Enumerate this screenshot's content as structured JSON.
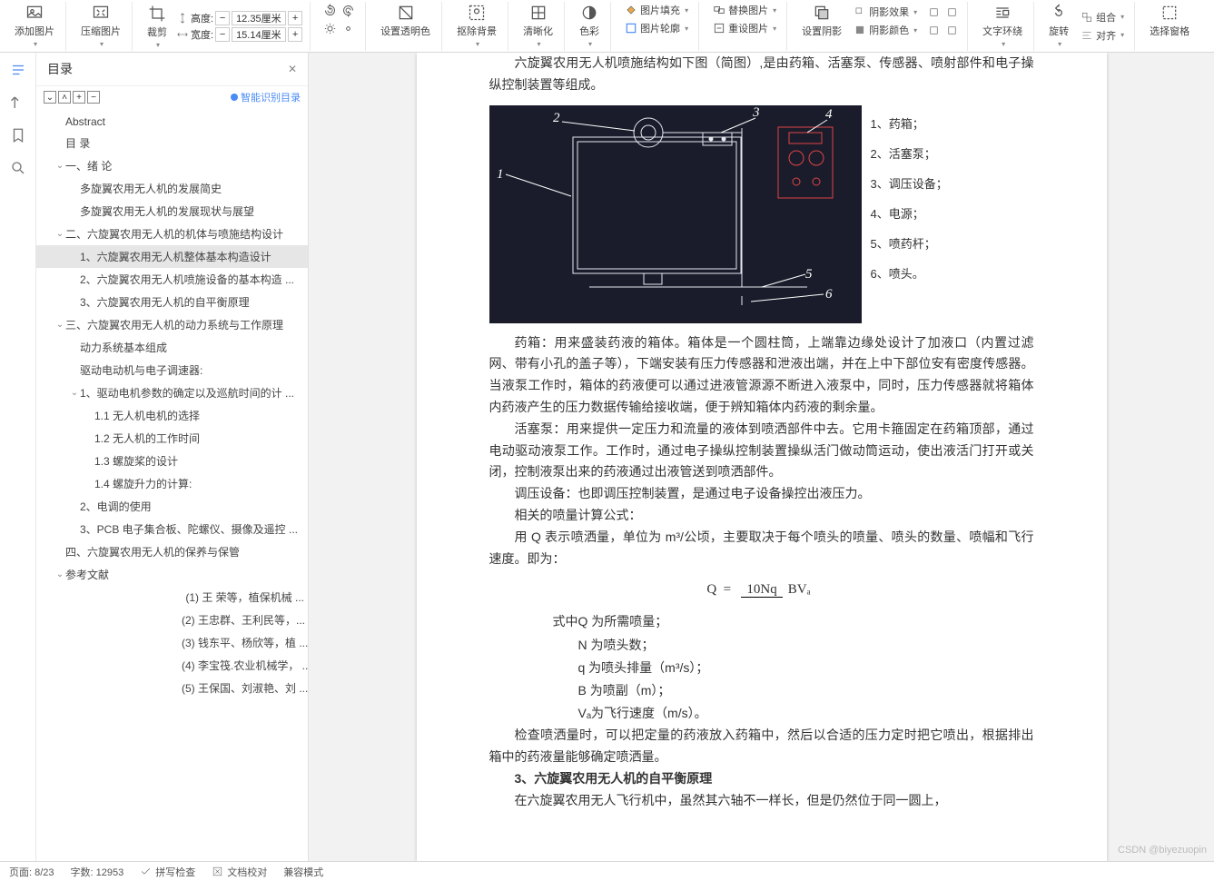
{
  "toolbar": {
    "add_image": "添加图片",
    "compress": "压缩图片",
    "crop": "裁剪",
    "height_label": "高度:",
    "height_val": "12.35厘米",
    "width_label": "宽度:",
    "width_val": "15.14厘米",
    "rotate_l": "↺",
    "rotate_r": "↻",
    "bright": "☀",
    "dim": "☼",
    "transparent": "设置透明色",
    "remove_bg": "抠除背景",
    "sharpen": "清晰化",
    "color": "色彩",
    "fill": "图片填充",
    "outline": "图片轮廓",
    "replace": "替换图片",
    "reset": "重设图片",
    "shadow": "设置阴影",
    "shadow_fx": "阴影效果",
    "shadow_color": "阴影颜色",
    "wrap": "文字环绕",
    "rotate": "旋转",
    "group": "组合",
    "align": "对齐",
    "select": "选择窗格"
  },
  "sidebar": {
    "title": "目录",
    "smart": "智能识别目录",
    "items": [
      {
        "t": "Abstract",
        "lv": 1
      },
      {
        "t": "目  录",
        "lv": 1
      },
      {
        "t": "一、绪  论",
        "lv": 1,
        "exp": true
      },
      {
        "t": "多旋翼农用无人机的发展简史",
        "lv": 2
      },
      {
        "t": "多旋翼农用无人机的发展现状与展望",
        "lv": 2
      },
      {
        "t": "二、六旋翼农用无人机的机体与喷施结构设计",
        "lv": 1,
        "exp": true
      },
      {
        "t": "1、六旋翼农用无人机整体基本构造设计",
        "lv": 2,
        "sel": true
      },
      {
        "t": "2、六旋翼农用无人机喷施设备的基本构造 ...",
        "lv": 2
      },
      {
        "t": "3、六旋翼农用无人机的自平衡原理",
        "lv": 2
      },
      {
        "t": "三、六旋翼农用无人机的动力系统与工作原理",
        "lv": 1,
        "exp": true
      },
      {
        "t": "动力系统基本组成",
        "lv": 2
      },
      {
        "t": "驱动电动机与电子调速器:",
        "lv": 2
      },
      {
        "t": "1、驱动电机参数的确定以及巡航时间的计 ...",
        "lv": 2,
        "exp": true
      },
      {
        "t": "1.1  无人机电机的选择",
        "lv": 3
      },
      {
        "t": "1.2  无人机的工作时间",
        "lv": 3
      },
      {
        "t": "1.3  螺旋桨的设计",
        "lv": 3
      },
      {
        "t": "1.4  螺旋升力的计算:",
        "lv": 3
      },
      {
        "t": "2、电调的使用",
        "lv": 2
      },
      {
        "t": "3、PCB 电子集合板、陀螺仪、摄像及遥控 ...",
        "lv": 2
      },
      {
        "t": "四、六旋翼农用无人机的保养与保管",
        "lv": 1
      },
      {
        "t": "参考文献",
        "lv": 1,
        "exp": true
      },
      {
        "t": "(1) 王  荣等，植保机械 ...",
        "lv": 7
      },
      {
        "t": "(2) 王忠群、王利民等，...",
        "lv": 7
      },
      {
        "t": "(3) 钱东平、杨欣等，植 ...",
        "lv": 7
      },
      {
        "t": "(4) 李宝筏.农业机械学， ...",
        "lv": 7
      },
      {
        "t": "(5) 王保国、刘淑艳、刘 ...",
        "lv": 7
      }
    ]
  },
  "doc": {
    "p0": "六旋翼农用无人机喷施结构如下图（简图）,是由药箱、活塞泵、传感器、喷射部件和电子操纵控制装置等组成。",
    "legend": [
      "1、药箱；",
      "2、活塞泵；",
      "3、调压设备；",
      "4、电源；",
      "5、喷药杆；",
      "6、喷头。"
    ],
    "cad_labels": {
      "n1": "1",
      "n2": "2",
      "n3": "3",
      "n4": "4",
      "n5": "5",
      "n6": "6"
    },
    "p1": "药箱：用来盛装药液的箱体。箱体是一个圆柱筒，上端靠边缘处设计了加液口（内置过滤网、带有小孔的盖子等），下端安装有压力传感器和泄液出端，并在上中下部位安有密度传感器。当液泵工作时，箱体的药液便可以通过进液管源源不断进入液泵中，同时，压力传感器就将箱体内药液产生的压力数据传输给接收端，便于辨知箱体内药液的剩余量。",
    "p2": "活塞泵：用来提供一定压力和流量的液体到喷洒部件中去。它用卡箍固定在药箱顶部，通过电动驱动液泵工作。工作时，通过电子操纵控制装置操纵活门做动筒运动，使出液活门打开或关闭，控制液泵出来的药液通过出液管送到喷洒部件。",
    "p3": "调压设备：也即调压控制装置，是通过电子设备操控出液压力。",
    "p4": "相关的喷量计算公式：",
    "p5": "用 Q 表示喷洒量，单位为 m³/公顷，主要取决于每个喷头的喷量、喷头的数量、喷幅和飞行速度。即为：",
    "formula": {
      "lhs": "Q",
      "eq": "=",
      "num": "10Nq",
      "den": "BVₐ"
    },
    "defs_label": "式中",
    "defs": [
      "Q 为所需喷量；",
      "N 为喷头数；",
      "q 为喷头排量（m³/s）；",
      "B 为喷副（m）；",
      "Vₐ为飞行速度（m/s）。"
    ],
    "p6": "检查喷洒量时，可以把定量的药液放入药箱中，然后以合适的压力定时把它喷出，根据排出箱中的药液量能够确定喷洒量。",
    "h3": "3、六旋翼农用无人机的自平衡原理",
    "p7": "在六旋翼农用无人飞行机中，虽然其六轴不一样长，但是仍然位于同一圆上，"
  },
  "status": {
    "page": "页面: 8/23",
    "words": "字数: 12953",
    "spell": "拼写检查",
    "proof": "文档校对",
    "compat": "兼容模式"
  },
  "watermark": "CSDN @biyezuopin"
}
